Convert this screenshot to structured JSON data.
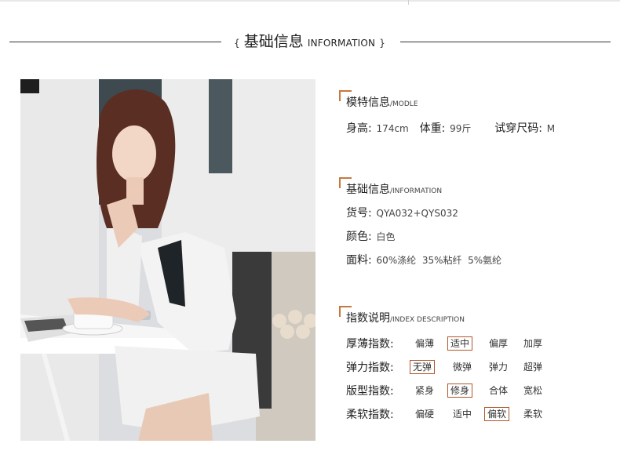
{
  "header": {
    "brace_open": "{",
    "title_cn": "基础信息",
    "title_en": "INFORMATION",
    "brace_close": "}"
  },
  "photo": {
    "description_icon": "model-photo"
  },
  "model_section": {
    "title_cn": "模特信息",
    "title_en": "/MODLE",
    "height_label": "身高:",
    "height_value": "174cm",
    "weight_label": "体重:",
    "weight_value": "99斤",
    "size_label": "试穿尺码:",
    "size_value": "M"
  },
  "basic_section": {
    "title_cn": "基础信息",
    "title_en": "/INFORMATION",
    "sku_label": "货号:",
    "sku_value": "QYA032+QYS032",
    "color_label": "颜色:",
    "color_value": "白色",
    "fabric_label": "面料:",
    "fabric_value": "60%涤纶  35%粘纤  5%氨纶"
  },
  "index_section": {
    "title_cn": "指数说明",
    "title_en": "/INDEX DESCRIPTION",
    "rows": [
      {
        "label": "厚薄指数:",
        "options": [
          "偏薄",
          "适中",
          "偏厚",
          "加厚"
        ],
        "selected": 1
      },
      {
        "label": "弹力指数:",
        "options": [
          "无弹",
          "微弹",
          "弹力",
          "超弹"
        ],
        "selected": 0
      },
      {
        "label": "版型指数:",
        "options": [
          "紧身",
          "修身",
          "合体",
          "宽松"
        ],
        "selected": 1
      },
      {
        "label": "柔软指数:",
        "options": [
          "偏硬",
          "适中",
          "偏软",
          "柔软"
        ],
        "selected": 2
      }
    ]
  },
  "colors": {
    "accent": "#c8773e",
    "selected_border": "#b0562b"
  }
}
